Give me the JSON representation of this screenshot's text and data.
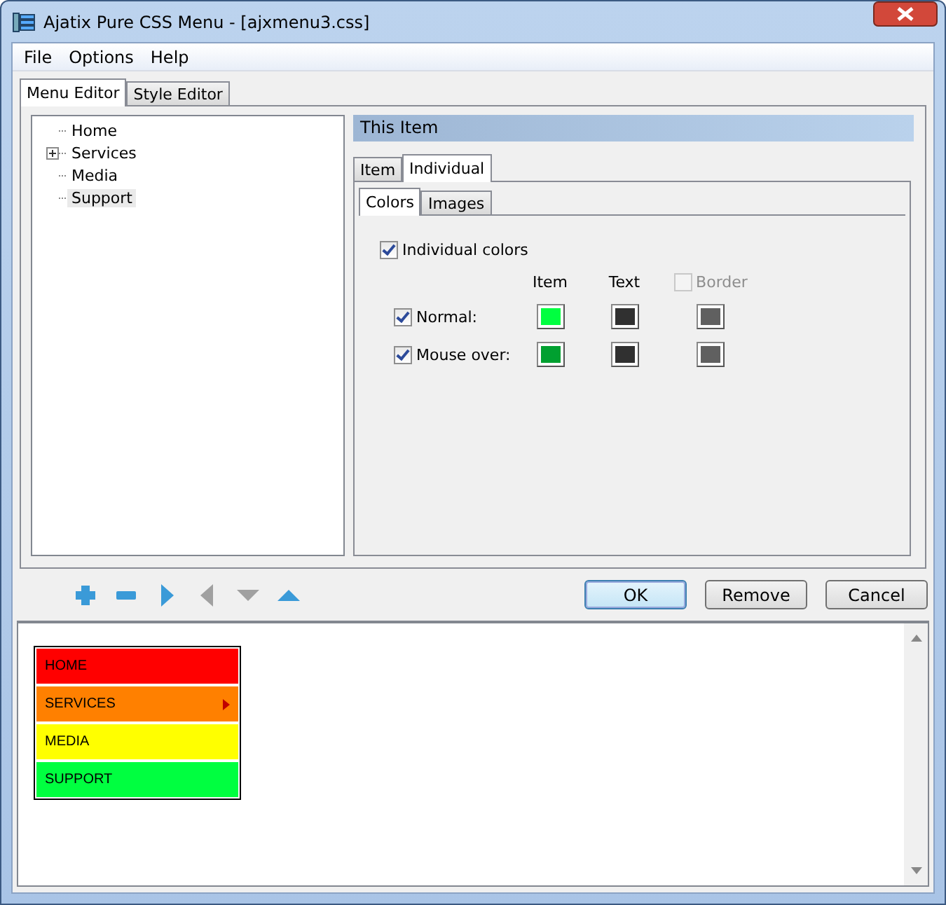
{
  "window": {
    "title": "Ajatix Pure CSS Menu - [ajxmenu3.css]"
  },
  "menu_bar": [
    "File",
    "Options",
    "Help"
  ],
  "tabs": [
    {
      "label": "Menu Editor",
      "selected": true
    },
    {
      "label": "Style Editor",
      "selected": false
    }
  ],
  "tree": [
    {
      "label": "Home",
      "expander": false,
      "selected": false
    },
    {
      "label": "Services",
      "expander": true,
      "selected": false
    },
    {
      "label": "Media",
      "expander": false,
      "selected": false
    },
    {
      "label": "Support",
      "expander": false,
      "selected": true
    }
  ],
  "item_panel": {
    "title": "This Item",
    "tabs": [
      {
        "label": "Item",
        "selected": false
      },
      {
        "label": "Individual",
        "selected": true
      }
    ],
    "subtabs": [
      {
        "label": "Colors",
        "selected": true
      },
      {
        "label": "Images",
        "selected": false
      }
    ],
    "individual_colors": {
      "label": "Individual colors",
      "checked": true
    },
    "columns": [
      {
        "label": "Item",
        "kind": "label"
      },
      {
        "label": "Text",
        "kind": "label"
      },
      {
        "label": "Border",
        "kind": "checkbox",
        "checked": false,
        "disabled": true
      }
    ],
    "rows": [
      {
        "label": "Normal:",
        "checked": true,
        "swatches": [
          {
            "color": "#00ff40"
          },
          {
            "color": "#303030"
          },
          {
            "color": "#606060"
          }
        ]
      },
      {
        "label": "Mouse over:",
        "checked": true,
        "swatches": [
          {
            "color": "#00a030"
          },
          {
            "color": "#303030"
          },
          {
            "color": "#606060"
          }
        ]
      }
    ]
  },
  "toolbar": [
    {
      "kind": "add",
      "disabled": false
    },
    {
      "kind": "remove",
      "disabled": false
    },
    {
      "kind": "right",
      "disabled": false
    },
    {
      "kind": "left",
      "disabled": true
    },
    {
      "kind": "down",
      "disabled": true
    },
    {
      "kind": "up",
      "disabled": false
    }
  ],
  "buttons": [
    {
      "label": "OK",
      "default": true
    },
    {
      "label": "Remove",
      "default": false
    },
    {
      "label": "Cancel",
      "default": false
    }
  ],
  "preview": [
    {
      "label": "HOME",
      "color": "#ff0000",
      "submenu": false
    },
    {
      "label": "SERVICES",
      "color": "#ff8000",
      "submenu": true
    },
    {
      "label": "MEDIA",
      "color": "#ffff00",
      "submenu": false
    },
    {
      "label": "SUPPORT",
      "color": "#00ff40",
      "submenu": false
    }
  ]
}
